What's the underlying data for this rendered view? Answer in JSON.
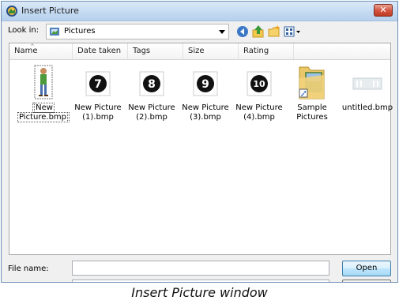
{
  "window": {
    "title": "Insert Picture",
    "close_glyph": "✕"
  },
  "look_in": {
    "label": "Look in:",
    "value": "Pictures"
  },
  "toolbar": {
    "icons": [
      "back-icon",
      "up-folder-icon",
      "new-folder-icon",
      "views-menu-icon"
    ]
  },
  "columns": [
    "Name",
    "Date taken",
    "Tags",
    "Size",
    "Rating"
  ],
  "files": [
    {
      "name": "New Picture.bmp",
      "line1": "New",
      "line2": "Picture.bmp",
      "icon": "person-thumbnail-icon",
      "selected": true
    },
    {
      "name": "New Picture (1).bmp",
      "line1": "New Picture",
      "line2": "(1).bmp",
      "icon": "number-7-icon",
      "glyph": "❼"
    },
    {
      "name": "New Picture (2).bmp",
      "line1": "New Picture",
      "line2": "(2).bmp",
      "icon": "number-8-icon",
      "glyph": "❽"
    },
    {
      "name": "New Picture (3).bmp",
      "line1": "New Picture",
      "line2": "(3).bmp",
      "icon": "number-9-icon",
      "glyph": "❾"
    },
    {
      "name": "New Picture (4).bmp",
      "line1": "New Picture",
      "line2": "(4).bmp",
      "icon": "number-10-icon",
      "glyph": "❿"
    },
    {
      "name": "Sample Pictures",
      "line1": "Sample",
      "line2": "Pictures",
      "icon": "folder-shortcut-icon"
    },
    {
      "name": "untitled.bmp",
      "line1": "untitled.bmp",
      "line2": "",
      "icon": "blank-bitmap-icon"
    }
  ],
  "file_name": {
    "label": "File name:",
    "value": ""
  },
  "buttons": {
    "open": "Open",
    "cancel": ""
  },
  "caption": "Insert Picture window",
  "colors": {
    "title_gradient": "#c3d9f1",
    "close_red": "#d2533e",
    "open_border": "#3c7fb1"
  }
}
